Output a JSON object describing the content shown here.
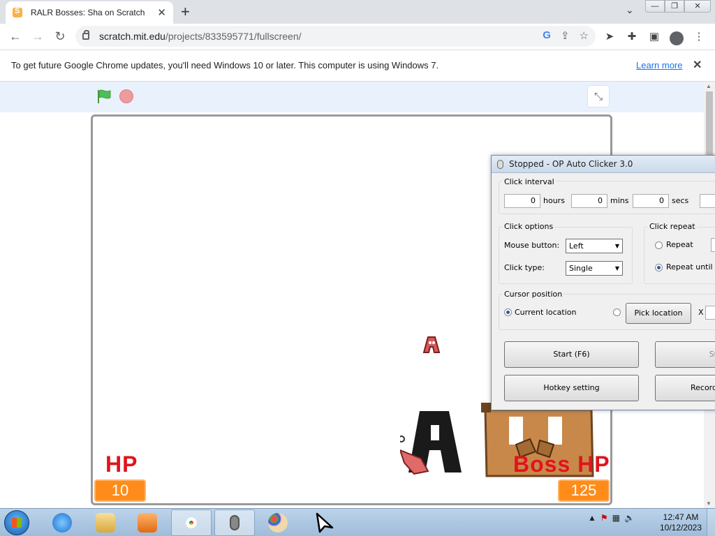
{
  "browser": {
    "tab_title": "RALR Bosses: Sha on Scratch",
    "url_host": "scratch.mit.edu",
    "url_path": "/projects/833595771/fullscreen/",
    "new_tab": "+",
    "tab_close": "✕",
    "window_buttons": [
      "—",
      "❐",
      "✕"
    ]
  },
  "infobar": {
    "message": "To get future Google Chrome updates, you'll need Windows 10 or later. This computer is using Windows 7.",
    "link": "Learn more",
    "close": "✕"
  },
  "stage": {
    "hp_label": "HP",
    "hp_value": "10",
    "boss_label": "Boss HP",
    "boss_value": "125"
  },
  "auto_clicker": {
    "title": "Stopped - OP Auto Clicker 3.0",
    "click_interval": {
      "label": "Click interval",
      "hours_value": "0",
      "hours_label": "hours",
      "mins_value": "0",
      "mins_label": "mins",
      "secs_value": "0",
      "secs_label": "secs"
    },
    "click_options": {
      "label": "Click options",
      "mouse_button_label": "Mouse button:",
      "mouse_button_value": "Left",
      "click_type_label": "Click type:",
      "click_type_value": "Single"
    },
    "click_repeat": {
      "label": "Click repeat",
      "repeat_label": "Repeat",
      "repeat_until_label": "Repeat until sto"
    },
    "cursor_position": {
      "label": "Cursor position",
      "current_location": "Current location",
      "pick_location": "Pick location",
      "x_label": "X"
    },
    "buttons": {
      "start": "Start (F6)",
      "stop": "St",
      "hotkey": "Hotkey setting",
      "record": "Record"
    }
  },
  "taskbar": {
    "time": "12:47 AM",
    "date": "10/12/2023"
  },
  "colors": {
    "hp_red": "#e0141c",
    "hp_box_orange": "#ff8c1a",
    "scratch_green_flag": "#4cbf56"
  }
}
